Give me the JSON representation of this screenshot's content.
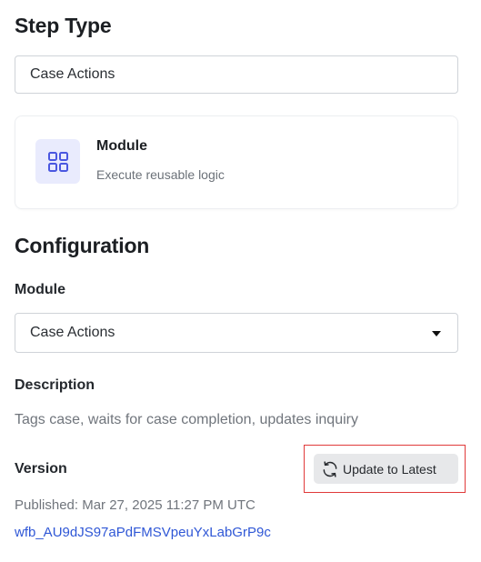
{
  "step_type": {
    "title": "Step Type",
    "selected_value": "Case Actions",
    "card": {
      "icon": "grid-icon",
      "title": "Module",
      "subtitle": "Execute reusable logic",
      "icon_bg": "#e9ebfd",
      "icon_color": "#4a57e0"
    }
  },
  "configuration": {
    "title": "Configuration",
    "module": {
      "label": "Module",
      "value": "Case Actions"
    },
    "description": {
      "label": "Description",
      "text": "Tags case, waits for case completion, updates inquiry"
    },
    "version": {
      "label": "Version",
      "update_button_label": "Update to Latest",
      "published": "Published: Mar 27, 2025 11:27 PM UTC",
      "id_link": "wfb_AU9dJS97aPdFMSVpeuYxLabGrP9c"
    }
  },
  "colors": {
    "link": "#2f57d6",
    "highlight": "#e03a3a",
    "button_bg": "#e7e8ea"
  }
}
